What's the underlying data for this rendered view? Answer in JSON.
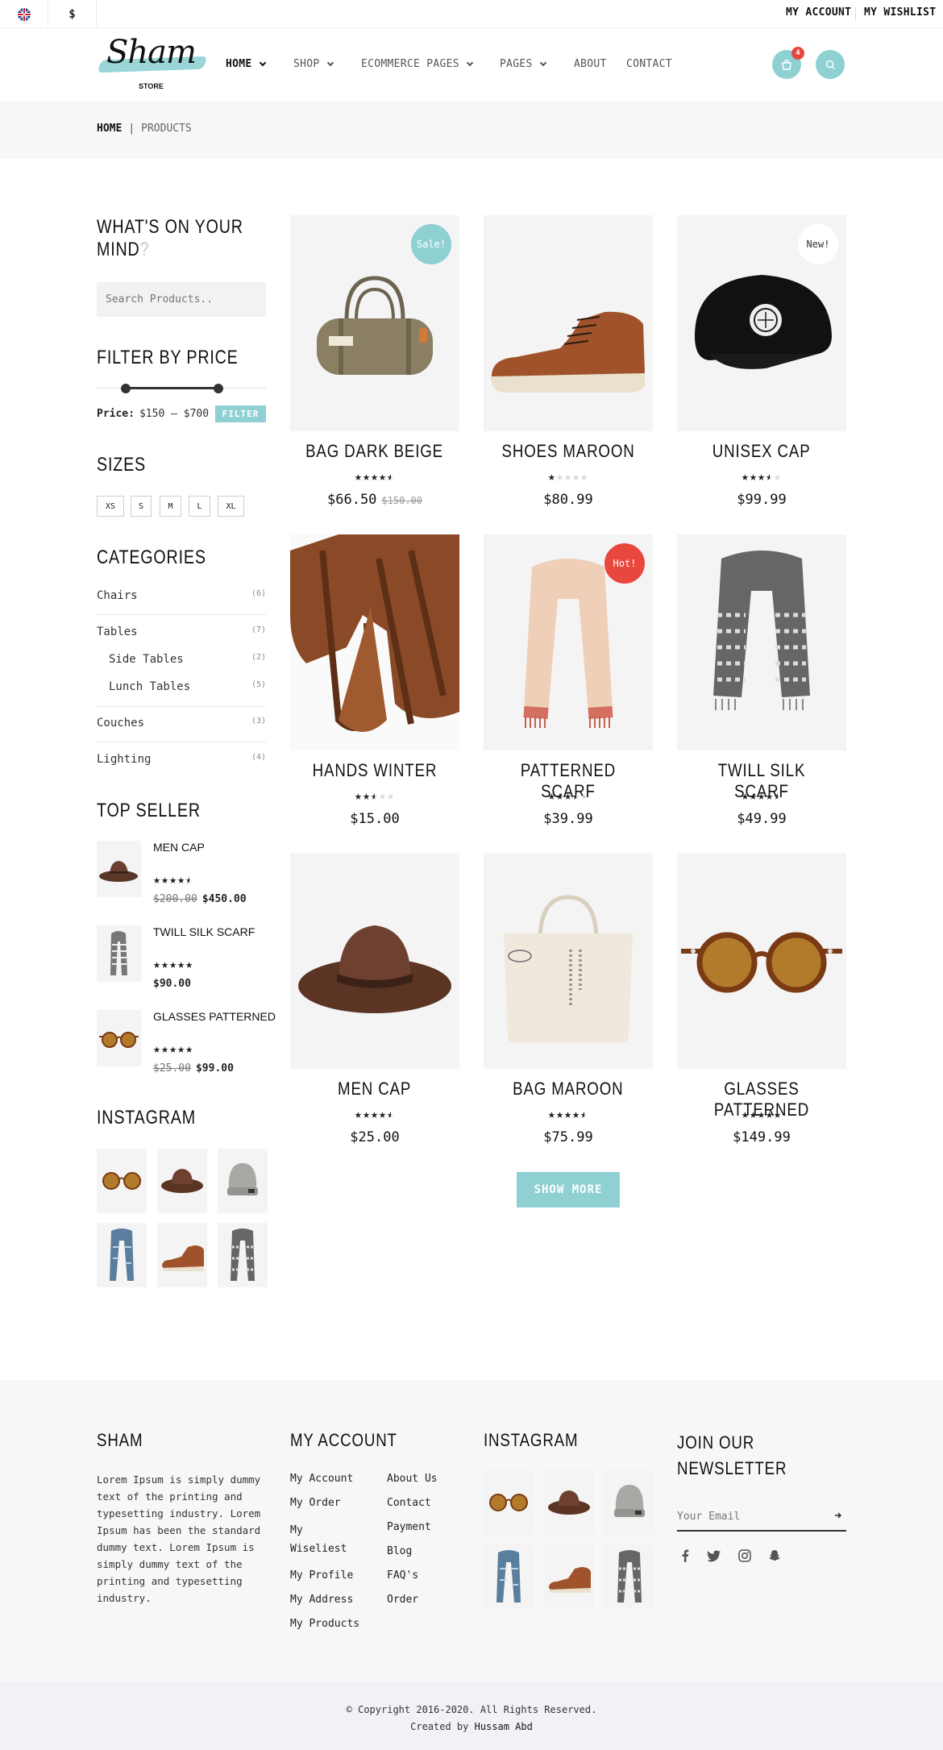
{
  "topbar": {
    "currency": "$",
    "my_account": "MY ACCOUNT",
    "my_wishlist": "MY WISHLIST"
  },
  "logo": {
    "script": "Sham",
    "sub": "STORE"
  },
  "nav": [
    {
      "label": "HOME",
      "has_dropdown": true,
      "active": true
    },
    {
      "label": "SHOP",
      "has_dropdown": true
    },
    {
      "label": "ECOMMERCE PAGES",
      "has_dropdown": true
    },
    {
      "label": "PAGES",
      "has_dropdown": true
    },
    {
      "label": "ABOUT",
      "has_dropdown": false
    },
    {
      "label": "CONTACT",
      "has_dropdown": false
    }
  ],
  "cart": {
    "count": "4"
  },
  "breadcrumb": {
    "home": "HOME",
    "sep": "|",
    "current": "PRODUCTS"
  },
  "sidebar": {
    "search": {
      "title_1": "WHAT'S ON YOUR",
      "title_2": "MIND",
      "title_q": "?",
      "placeholder": "Search Products.."
    },
    "price": {
      "title": "FILTER BY PRICE",
      "label": "Price:",
      "range": "$150 — $700",
      "button": "FILTER",
      "low_fraction": 0.17,
      "high_fraction": 0.72
    },
    "sizes": {
      "title": "SIZES",
      "items": [
        "XS",
        "S",
        "M",
        "L",
        "XL"
      ]
    },
    "categories": {
      "title": "CATEGORIES",
      "items": [
        {
          "label": "Chairs",
          "count": "(6)"
        },
        {
          "label": "Tables",
          "count": "(7)"
        },
        {
          "label": "Side Tables",
          "count": "(2)"
        },
        {
          "label": "Lunch Tables",
          "count": "(5)"
        },
        {
          "label": "Couches",
          "count": "(3)"
        },
        {
          "label": "Lighting",
          "count": "(4)"
        }
      ]
    },
    "top_seller": {
      "title": "TOP SELLER",
      "items": [
        {
          "name": "MEN CAP",
          "rating": 4.5,
          "old_price": "$200.00",
          "price": "$450.00"
        },
        {
          "name": "TWILL SILK SCARF",
          "rating": 5,
          "old_price": "",
          "price": "$90.00"
        },
        {
          "name": "GLASSES PATTERNED",
          "rating": 5,
          "old_price": "$25.00",
          "price": "$99.00"
        }
      ]
    },
    "instagram": {
      "title": "INSTAGRAM"
    }
  },
  "products": [
    {
      "name": "BAG DARK BEIGE",
      "rating": 4.5,
      "price": "$66.50",
      "old_price": "$150.00",
      "badge": "Sale!",
      "badge_color": "#8fd0d3",
      "image": "duffle-bag"
    },
    {
      "name": "SHOES MAROON",
      "rating": 1,
      "price": "$80.99",
      "old_price": "",
      "badge": "",
      "image": "sneaker"
    },
    {
      "name": "UNISEX CAP",
      "rating": 3.5,
      "price": "$99.99",
      "old_price": "",
      "badge": "New!",
      "badge_color": "#ffffff",
      "image": "cap"
    },
    {
      "name": "HANDS WINTER",
      "rating": 2.5,
      "price": "$15.00",
      "old_price": "",
      "badge": "",
      "image": "gloves"
    },
    {
      "name": "PATTERNED SCARF",
      "rating": 3.5,
      "price": "$39.99",
      "old_price": "",
      "badge": "Hot!",
      "badge_color": "#e8473e",
      "image": "scarf-pink"
    },
    {
      "name": "TWILL SILK SCARF",
      "rating": 4.5,
      "price": "$49.99",
      "old_price": "",
      "badge": "",
      "image": "scarf-grey"
    },
    {
      "name": "MEN CAP",
      "rating": 4.5,
      "price": "$25.00",
      "old_price": "",
      "badge": "",
      "image": "hat"
    },
    {
      "name": "BAG MAROON",
      "rating": 4.5,
      "price": "$75.99",
      "old_price": "",
      "badge": "",
      "image": "tote"
    },
    {
      "name": "GLASSES PATTERNED",
      "rating": 5,
      "price": "$149.99",
      "old_price": "",
      "badge": "",
      "image": "glasses"
    }
  ],
  "show_more": "SHOW MORE",
  "footer": {
    "about": {
      "title": "SHAM",
      "text": "Lorem Ipsum is simply dummy text of the printing and typesetting industry. Lorem Ipsum has been the standard dummy text. Lorem Ipsum is simply dummy text of the printing and typesetting industry."
    },
    "account": {
      "title": "MY ACCOUNT",
      "col1": [
        "My Account",
        "My Order",
        "My Wiseliest",
        "My Profile",
        "My Address",
        "My Products"
      ],
      "col2": [
        "About Us",
        "Contact",
        "Payment",
        "Blog",
        "FAQ's",
        "Order"
      ]
    },
    "instagram": {
      "title": "INSTAGRAM"
    },
    "newsletter": {
      "title_1": "JOIN OUR",
      "title_2": "NEWSLETTER",
      "placeholder": "Your Email"
    },
    "copyright": "© Copyright 2016-2020. All Rights Reserved.",
    "created_prefix": "Created by",
    "author": "Hussam Abd"
  },
  "colors": {
    "accent": "#8fd0d3",
    "hot": "#e8473e",
    "text": "#222222"
  }
}
